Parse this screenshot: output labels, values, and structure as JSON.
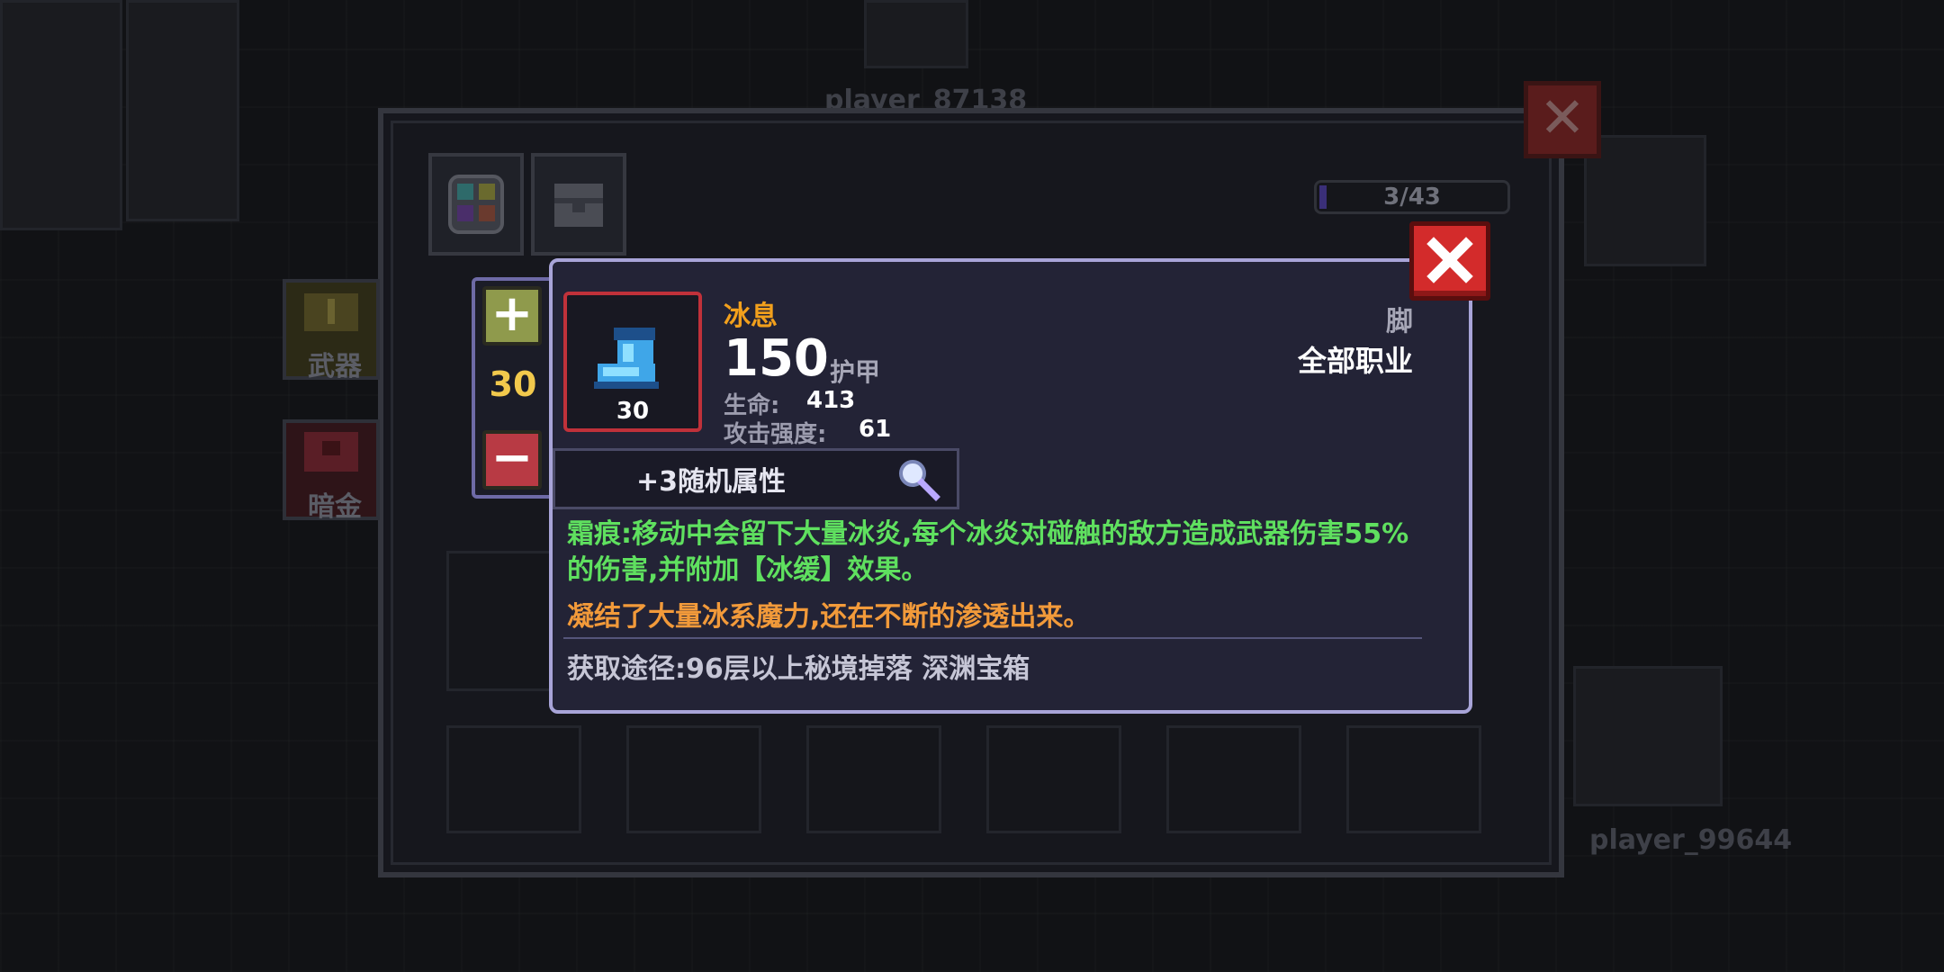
{
  "background": {
    "player_names": [
      "player_87138",
      "player_99644"
    ]
  },
  "inventory": {
    "capacity_counter": "3/43",
    "capacity_fraction": 0.07,
    "side_tabs": [
      {
        "label": "武器",
        "icon": "sword-icon"
      },
      {
        "label": "暗金",
        "icon": "chest-icon"
      }
    ],
    "top_buttons": [
      {
        "icon": "color-grid-icon"
      },
      {
        "icon": "treasure-chest-icon"
      }
    ]
  },
  "quantity": {
    "value": "30",
    "plus_symbol": "+",
    "minus_symbol": "−"
  },
  "tooltip": {
    "name": "冰息",
    "armor_value": "150",
    "armor_label": "护甲",
    "level": "30",
    "stats": [
      {
        "label": "生命:",
        "value": "413"
      },
      {
        "label": "攻击强度:",
        "value": "61"
      }
    ],
    "slot_type": "脚",
    "class_requirement": "全部职业",
    "random_attribute": "+3随机属性",
    "effect_text": "霜痕:移动中会留下大量冰炎,每个冰炎对碰触的敌方造成武器伤害55%的伤害,并附加【冰缓】效果。",
    "flavor_text": "凝结了大量冰系魔力,还在不断的渗透出来。",
    "source_text": "获取途径:96层以上秘境掉落 深渊宝箱"
  },
  "colors": {
    "name": "#f2a01c",
    "effect": "#5fe05f",
    "flavor": "#f29a3a",
    "frame": "#c0313a",
    "close": "#d32b2b"
  }
}
